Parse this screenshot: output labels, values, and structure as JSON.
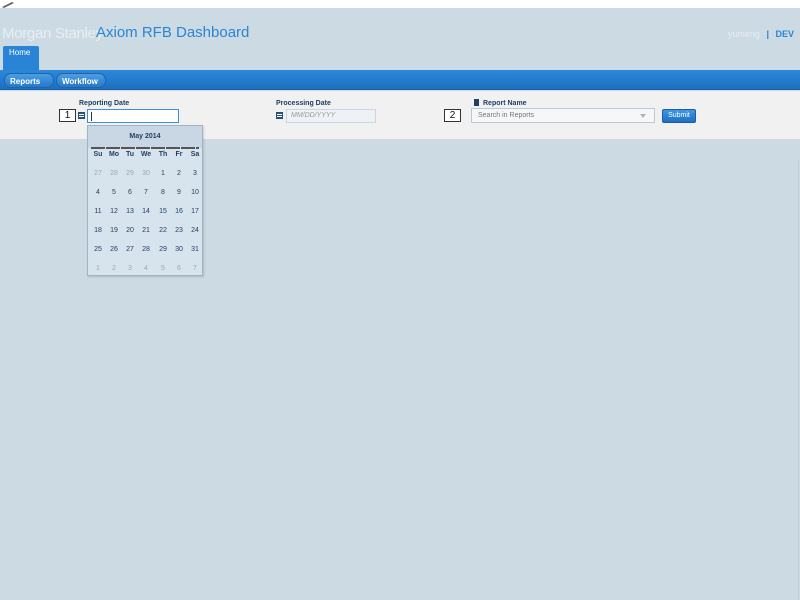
{
  "header": {
    "logo_text": "Morgan Stanley",
    "app_title": "Axiom RFB Dashboard",
    "username": "yumeng",
    "separator": "|",
    "environment": "DEV"
  },
  "tabs": {
    "home_label": "Home"
  },
  "nav": {
    "reports_label": "Reports",
    "workflow_label": "Workflow"
  },
  "filters": {
    "reporting_date": {
      "label": "Reporting Date",
      "marker": "1",
      "value": ""
    },
    "processing_date": {
      "label": "Processing Date",
      "placeholder": "MM/DD/YYYY"
    },
    "report_name": {
      "label": "Report Name",
      "marker": "2",
      "placeholder": "Search in Reports"
    },
    "submit_label": "Submit"
  },
  "calendar": {
    "month_label": "May 2014",
    "weekdays": [
      "Su",
      "Mo",
      "Tu",
      "We",
      "Th",
      "Fr",
      "Sa"
    ],
    "weeks": [
      [
        {
          "d": "27",
          "o": true
        },
        {
          "d": "28",
          "o": true
        },
        {
          "d": "29",
          "o": true
        },
        {
          "d": "30",
          "o": true
        },
        {
          "d": "1",
          "o": false
        },
        {
          "d": "2",
          "o": false
        },
        {
          "d": "3",
          "o": false
        }
      ],
      [
        {
          "d": "4",
          "o": false
        },
        {
          "d": "5",
          "o": false
        },
        {
          "d": "6",
          "o": false
        },
        {
          "d": "7",
          "o": false
        },
        {
          "d": "8",
          "o": false
        },
        {
          "d": "9",
          "o": false
        },
        {
          "d": "10",
          "o": false
        }
      ],
      [
        {
          "d": "11",
          "o": false
        },
        {
          "d": "12",
          "o": false
        },
        {
          "d": "13",
          "o": false
        },
        {
          "d": "14",
          "o": false
        },
        {
          "d": "15",
          "o": false
        },
        {
          "d": "16",
          "o": false
        },
        {
          "d": "17",
          "o": false
        }
      ],
      [
        {
          "d": "18",
          "o": false
        },
        {
          "d": "19",
          "o": false
        },
        {
          "d": "20",
          "o": false
        },
        {
          "d": "21",
          "o": false
        },
        {
          "d": "22",
          "o": false
        },
        {
          "d": "23",
          "o": false
        },
        {
          "d": "24",
          "o": false
        }
      ],
      [
        {
          "d": "25",
          "o": false
        },
        {
          "d": "26",
          "o": false
        },
        {
          "d": "27",
          "o": false
        },
        {
          "d": "28",
          "o": false
        },
        {
          "d": "29",
          "o": false
        },
        {
          "d": "30",
          "o": false
        },
        {
          "d": "31",
          "o": false
        }
      ],
      [
        {
          "d": "1",
          "o": true
        },
        {
          "d": "2",
          "o": true
        },
        {
          "d": "3",
          "o": true
        },
        {
          "d": "4",
          "o": true
        },
        {
          "d": "5",
          "o": true
        },
        {
          "d": "6",
          "o": true
        },
        {
          "d": "7",
          "o": true
        }
      ]
    ]
  },
  "colors": {
    "accent": "#2a85d4",
    "background": "#ccdae4",
    "navbar": "#1d6fbf",
    "label_text": "#1f3f63"
  },
  "icons": {
    "calendar": "calendar-icon",
    "report": "document-icon",
    "dropdown": "chevron-down-icon"
  }
}
